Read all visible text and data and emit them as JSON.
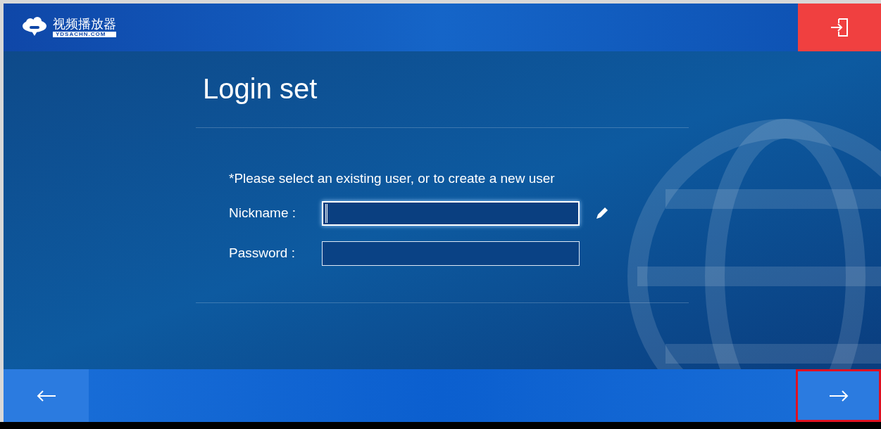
{
  "header": {
    "logo_title": "视频播放器",
    "logo_subtitle": "YDSACHN.COM"
  },
  "page": {
    "title": "Login set",
    "hint": "*Please select an existing user, or to create a new user"
  },
  "fields": [
    {
      "label": "Nickname :",
      "kind": "editable",
      "focused": true
    },
    {
      "label": "Password :",
      "kind": "plain",
      "focused": false
    }
  ],
  "footer": {
    "next_highlighted": true
  }
}
